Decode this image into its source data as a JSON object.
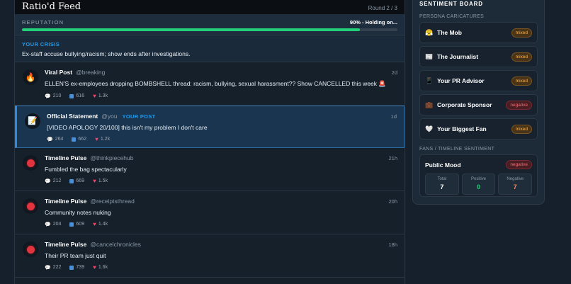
{
  "feed": {
    "title": "Ratio'd Feed",
    "round": "Round 2 / 3"
  },
  "reputation": {
    "label": "REPUTATION",
    "status": "90% - Holding on...",
    "value_percent": 90,
    "fill_color": "#22d07a"
  },
  "crisis": {
    "label": "YOUR CRISIS",
    "text": "Ex-staff accuse bullying/racism; show ends after investigations."
  },
  "posts": [
    {
      "avatar_icon": "flame-icon",
      "author": "Viral Post",
      "handle": "@breaking",
      "badge": "",
      "time": "2d",
      "text": "ELLEN'S ex-employees dropping BOMBSHELL thread: racism, bullying, sexual harassment?? Show CANCELLED this week 🚨",
      "comments": "210",
      "reposts": "616",
      "likes": "1.3k"
    },
    {
      "avatar_icon": "document-icon",
      "author": "Official Statement",
      "handle": "@you",
      "badge": "YOUR POST",
      "time": "1d",
      "text": "[VIDEO APOLOGY 20/100] this isn't my problem I don't care",
      "comments": "264",
      "reposts": "662",
      "likes": "1.2k"
    },
    {
      "avatar_icon": "red-dot-icon",
      "author": "Timeline Pulse",
      "handle": "@thinkpiecehub",
      "badge": "",
      "time": "21h",
      "text": "Fumbled the bag spectacularly",
      "comments": "212",
      "reposts": "669",
      "likes": "1.5k"
    },
    {
      "avatar_icon": "red-dot-icon",
      "author": "Timeline Pulse",
      "handle": "@receiptsthread",
      "badge": "",
      "time": "20h",
      "text": "Community notes nuking",
      "comments": "204",
      "reposts": "609",
      "likes": "1.4k"
    },
    {
      "avatar_icon": "red-dot-icon",
      "author": "Timeline Pulse",
      "handle": "@cancelchronicles",
      "badge": "",
      "time": "18h",
      "text": "Their PR team just quit",
      "comments": "222",
      "reposts": "739",
      "likes": "1.6k"
    }
  ],
  "board": {
    "title": "SENTIMENT BOARD",
    "personas_label": "PERSONA CARICATURES",
    "personas": [
      {
        "icon": "😤",
        "icon_name": "angry-face-icon",
        "name": "The Mob",
        "sentiment": "mixed"
      },
      {
        "icon": "📰",
        "icon_name": "newspaper-icon",
        "name": "The Journalist",
        "sentiment": "mixed"
      },
      {
        "icon": "📱",
        "icon_name": "phone-icon",
        "name": "Your PR Advisor",
        "sentiment": "mixed"
      },
      {
        "icon": "💼",
        "icon_name": "briefcase-icon",
        "name": "Corporate Sponsor",
        "sentiment": "negative"
      },
      {
        "icon": "🤍",
        "icon_name": "heart-icon",
        "name": "Your Biggest Fan",
        "sentiment": "mixed"
      }
    ],
    "fans_label": "FANS / TIMELINE SENTIMENT",
    "mood": {
      "title": "Public Mood",
      "sentiment": "negative",
      "total_label": "Total",
      "total": "7",
      "positive_label": "Positive",
      "positive": "0",
      "negative_label": "Negative",
      "negative": "7",
      "colors": {
        "total": "#ffffff",
        "positive": "#22d07a",
        "negative": "#f08a6a"
      }
    }
  }
}
